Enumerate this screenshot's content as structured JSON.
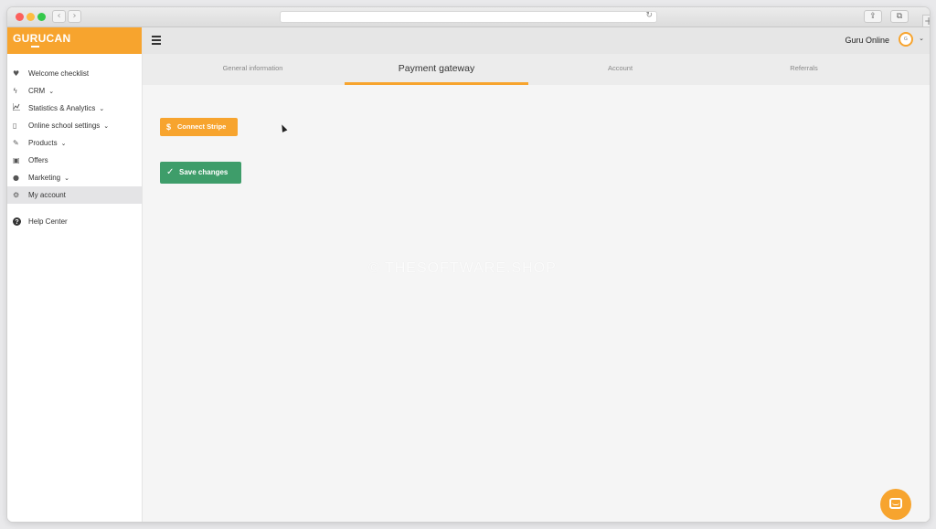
{
  "browser": {
    "back": "‹",
    "forward": "›",
    "reload": "↻",
    "share": "⇪",
    "tabs": "⧉",
    "new_tab": "+"
  },
  "brand": {
    "part1": "GURU",
    "part2": "CAN",
    "color": "#f7a42e"
  },
  "sidebar": {
    "items": [
      {
        "icon": "heart-icon",
        "glyph": "♥",
        "label": "Welcome checklist",
        "chevron": ""
      },
      {
        "icon": "bolt-icon",
        "glyph": "ϟ",
        "label": "CRM",
        "chevron": "⌄"
      },
      {
        "icon": "chart-icon",
        "glyph": "📈",
        "label": "Statistics & Analytics",
        "chevron": "⌄"
      },
      {
        "icon": "phone-icon",
        "glyph": "▯",
        "label": "Online school settings",
        "chevron": "⌄"
      },
      {
        "icon": "pencil-icon",
        "glyph": "✎",
        "label": "Products",
        "chevron": "⌄"
      },
      {
        "icon": "video-icon",
        "glyph": "▣",
        "label": "Offers",
        "chevron": ""
      },
      {
        "icon": "comment-icon",
        "glyph": "●",
        "label": "Marketing",
        "chevron": "⌄"
      },
      {
        "icon": "gear-icon",
        "glyph": "⚙",
        "label": "My account",
        "chevron": ""
      }
    ],
    "help": {
      "icon": "question-icon",
      "glyph": "?",
      "label": "Help Center"
    }
  },
  "topbar": {
    "user_name": "Guru Online",
    "avatar_text": "G",
    "chevron": "⌄"
  },
  "tabs": [
    "General information",
    "Payment gateway",
    "Account",
    "Referrals"
  ],
  "active_tab": "Payment gateway",
  "content": {
    "connect_button": "Connect Stripe",
    "connect_icon": "$",
    "save_button": "Save changes",
    "save_icon": "✓"
  },
  "watermark": "© THESOFTWARE.SHOP"
}
